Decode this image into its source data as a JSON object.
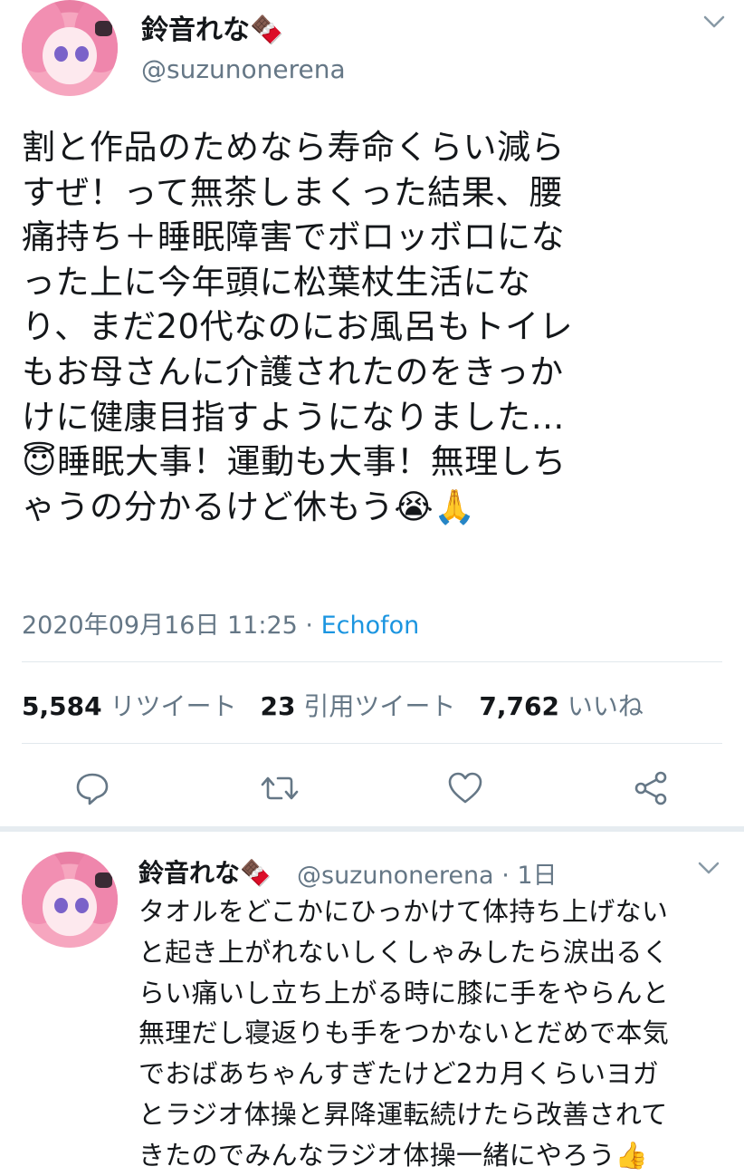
{
  "tweet": {
    "author_name": "鈴音れな🍫",
    "author_handle": "@suzunonerena",
    "text": "割と作品のためなら寿命くらい減ら\nすぜ！って無茶しまくった結果、腰\n痛持ち＋睡眠障害でボロッボロにな\nった上に今年頭に松葉杖生活にな\nり、まだ20代なのにお風呂もトイレ\nもお母さんに介護されたのをきっか\nけに健康目指すようになりました…\n😇睡眠大事！運動も大事！無理しち\nゃうの分かるけど休もう😭🙏",
    "date": "2020年09月16日 11:25",
    "separator": " · ",
    "source": "Echofon",
    "stats": {
      "retweets_count": "5,584",
      "retweets_label": "リツイート",
      "quotes_count": "23",
      "quotes_label": "引用ツイート",
      "likes_count": "7,762",
      "likes_label": "いいね"
    },
    "actions": [
      "reply-icon",
      "retweet-icon",
      "like-icon",
      "share-icon"
    ]
  },
  "reply": {
    "author_name": "鈴音れな🍫",
    "author_handle": "@suzunonerena",
    "time": "· 1日",
    "text": "タオルをどこかにひっかけて体持ち上げない\nと起き上がれないしくしゃみしたら涙出るく\nらい痛いし立ち上がる時に膝に手をやらんと\n無理だし寝返りも手をつかないとだめで本気\nでおばあちゃんすぎたけど2カ月くらいヨガ\nとラジオ体操と昇降運転続けたら改善されて\nきたのでみんなラジオ体操一緒にやろう👍"
  },
  "colors": {
    "text": "#14171a",
    "secondary": "#657786",
    "link": "#1b95e0",
    "divider": "#e1e8ed"
  }
}
